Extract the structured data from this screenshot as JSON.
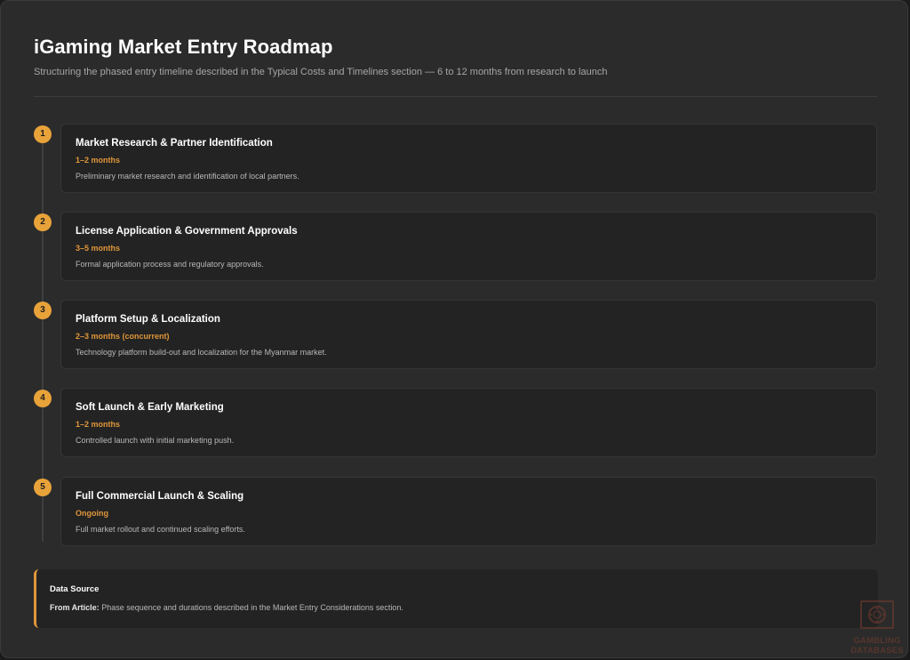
{
  "header": {
    "title": "iGaming Market Entry Roadmap",
    "subtitle": "Structuring the phased entry timeline described in the Typical Costs and Timelines section — 6 to 12 months from research to launch"
  },
  "colors": {
    "accent": "#e8a23a",
    "duration": "#e0963a",
    "background": "#2b2b2b",
    "card": "#232323"
  },
  "phases": [
    {
      "number": "1",
      "title": "Market Research & Partner Identification",
      "duration": "1–2 months",
      "description": "Preliminary market research and identification of local partners."
    },
    {
      "number": "2",
      "title": "License Application & Government Approvals",
      "duration": "3–5 months",
      "description": "Formal application process and regulatory approvals."
    },
    {
      "number": "3",
      "title": "Platform Setup & Localization",
      "duration": "2–3 months (concurrent)",
      "description": "Technology platform build-out and localization for the Myanmar market."
    },
    {
      "number": "4",
      "title": "Soft Launch & Early Marketing",
      "duration": "1–2 months",
      "description": "Controlled launch with initial marketing push."
    },
    {
      "number": "5",
      "title": "Full Commercial Launch & Scaling",
      "duration": "Ongoing",
      "description": "Full market rollout and continued scaling efforts."
    }
  ],
  "source": {
    "title": "Data Source",
    "label": "From Article:",
    "text": " Phase sequence and durations described in the Market Entry Considerations section."
  },
  "watermark": {
    "icon": "casino-chip-icon",
    "text": "GAMBLING DATABASES"
  }
}
